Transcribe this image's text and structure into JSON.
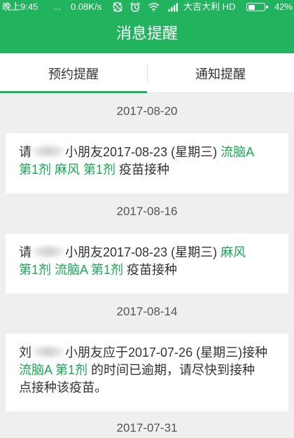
{
  "status_bar": {
    "time": "晚上9:45",
    "overflow_dots": "...",
    "net_speed": "0.08K/s",
    "carrier": "大吉大利 HD",
    "battery_text": "42%",
    "battery_level": 0.42,
    "icons": {
      "sync": "sync-icon",
      "alarm": "alarm-icon",
      "wifi": "wifi-icon",
      "signal": "signal-icon",
      "battery": "battery-icon"
    }
  },
  "header": {
    "title": "消息提醒"
  },
  "tabs": [
    {
      "label": "预约提醒",
      "active": true
    },
    {
      "label": "通知提醒",
      "active": false
    }
  ],
  "colors": {
    "brand_green": "#22b35e",
    "highlight_text": "#1aa957",
    "page_background": "#efefef",
    "card_background": "#ffffff",
    "body_text": "#333333",
    "date_text": "#555555",
    "tab_text": "#333333"
  },
  "messages": [
    {
      "date": "2017-08-20",
      "lines": [
        [
          {
            "text": "请"
          },
          {
            "text": "小朋友2017-08-23 (星期三) "
          },
          {
            "text": "流脑A",
            "highlight": true
          }
        ],
        [
          {
            "text": "第1剂 麻风 第1剂",
            "highlight": true
          },
          {
            "text": " 疫苗接种"
          }
        ]
      ]
    },
    {
      "date": "2017-08-16",
      "lines": [
        [
          {
            "text": "请"
          },
          {
            "text": "小朋友2017-08-23 (星期三) "
          },
          {
            "text": "麻风",
            "highlight": true
          }
        ],
        [
          {
            "text": "第1剂 流脑A 第1剂",
            "highlight": true
          },
          {
            "text": " 疫苗接种"
          }
        ]
      ]
    },
    {
      "date": "2017-08-14",
      "lines": [
        [
          {
            "text": "刘"
          },
          {
            "text": "小朋友应于2017-07-26 (星期三)接种"
          }
        ],
        [
          {
            "text": "流脑A 第1剂",
            "highlight": true
          },
          {
            "text": " 的时间已逾期，请尽快到接种"
          }
        ],
        [
          {
            "text": "点接种该疫苗。"
          }
        ]
      ]
    },
    {
      "date": "2017-07-31"
    }
  ]
}
